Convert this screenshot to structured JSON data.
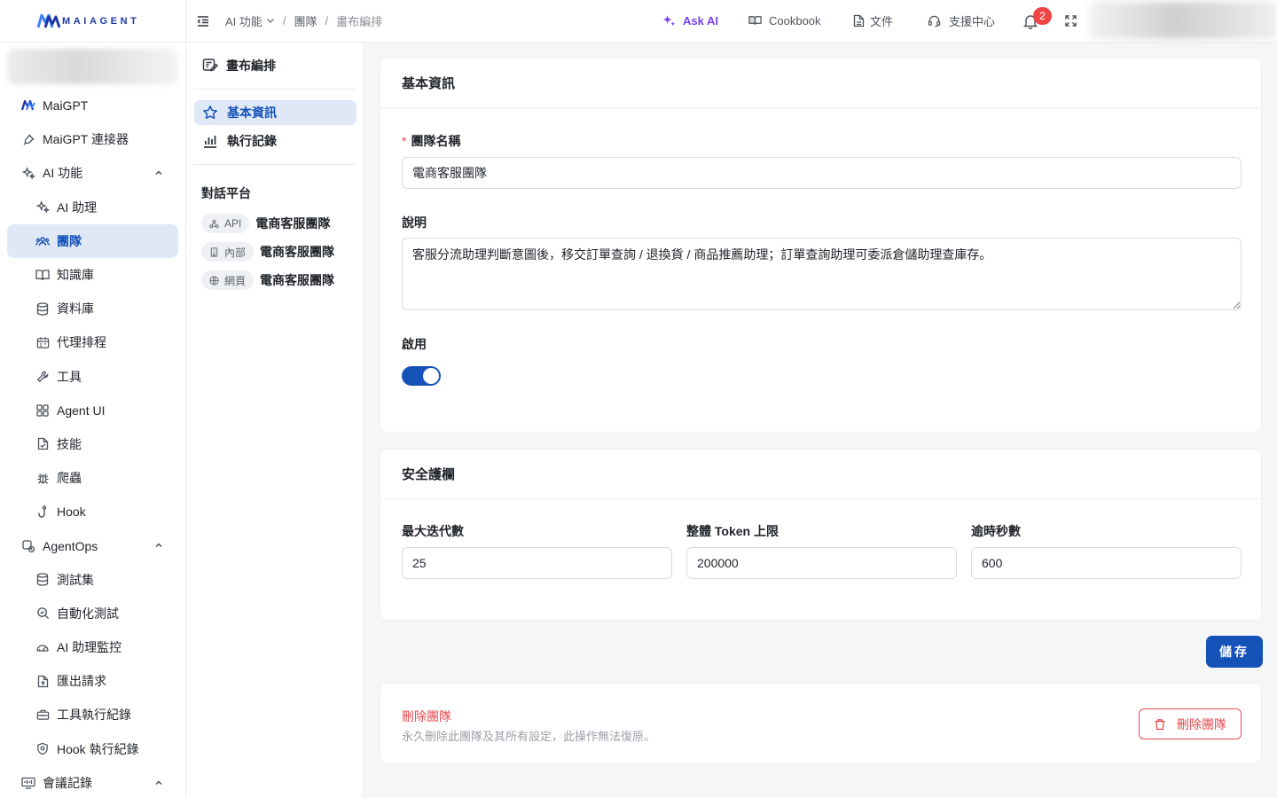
{
  "brand": {
    "name": "MAIAGENT"
  },
  "sidebar": {
    "items": [
      {
        "label": "MaiGPT",
        "icon": "maigpt-logo-icon"
      },
      {
        "label": "MaiGPT 連接器",
        "icon": "plug-icon"
      },
      {
        "label": "AI 功能",
        "icon": "sparkles-icon",
        "expanded": true
      },
      {
        "label": "AI 助理",
        "icon": "sparkle-icon"
      },
      {
        "label": "團隊",
        "icon": "team-icon",
        "active": true
      },
      {
        "label": "知識庫",
        "icon": "book-icon"
      },
      {
        "label": "資料庫",
        "icon": "database-icon"
      },
      {
        "label": "代理排程",
        "icon": "calendar-icon"
      },
      {
        "label": "工具",
        "icon": "wrench-icon"
      },
      {
        "label": "Agent UI",
        "icon": "grid-icon"
      },
      {
        "label": "技能",
        "icon": "file-icon"
      },
      {
        "label": "爬蟲",
        "icon": "bug-icon"
      },
      {
        "label": "Hook",
        "icon": "hook-icon"
      },
      {
        "label": "AgentOps",
        "icon": "agentops-icon",
        "expanded": true
      },
      {
        "label": "測試集",
        "icon": "database-icon"
      },
      {
        "label": "自動化測試",
        "icon": "search-icon"
      },
      {
        "label": "AI 助理監控",
        "icon": "gauge-icon"
      },
      {
        "label": "匯出請求",
        "icon": "export-icon"
      },
      {
        "label": "工具執行紀錄",
        "icon": "toolbox-icon"
      },
      {
        "label": "Hook 執行紀錄",
        "icon": "shield-icon"
      },
      {
        "label": "會議記錄",
        "icon": "meeting-icon",
        "expanded": true
      }
    ]
  },
  "topbar": {
    "breadcrumb": [
      "AI 功能",
      "團隊",
      "畫布編排"
    ],
    "ask_ai": "Ask AI",
    "cookbook": "Cookbook",
    "docs": "文件",
    "support": "支援中心",
    "notification_count": "2"
  },
  "subpanel": {
    "header": "畫布編排",
    "items": [
      {
        "label": "基本資訊",
        "icon": "star-icon",
        "active": true
      },
      {
        "label": "執行記錄",
        "icon": "bar-chart-icon"
      }
    ],
    "platform_section": "對話平台",
    "platforms": [
      {
        "tag": "API",
        "name": "電商客服團隊",
        "icon": "api-icon"
      },
      {
        "tag": "內部",
        "name": "電商客服團隊",
        "icon": "building-icon"
      },
      {
        "tag": "網頁",
        "name": "電商客服團隊",
        "icon": "globe-icon"
      }
    ]
  },
  "basic_info": {
    "title": "基本資訊",
    "name_label": "團隊名稱",
    "name_value": "電商客服團隊",
    "desc_label": "說明",
    "desc_value": "客服分流助理判斷意圖後，移交訂單查詢 / 退換貨 / 商品推薦助理；訂單查詢助理可委派倉儲助理查庫存。",
    "enabled_label": "啟用",
    "enabled": true
  },
  "guardrails": {
    "title": "安全護欄",
    "fields": [
      {
        "label": "最大迭代數",
        "value": "25"
      },
      {
        "label": "整體 Token 上限",
        "value": "200000"
      },
      {
        "label": "逾時秒數",
        "value": "600"
      }
    ]
  },
  "save_label": "儲存",
  "danger": {
    "title": "刪除團隊",
    "description": "永久刪除此團隊及其所有設定，此操作無法復原。",
    "button": "刪除團隊"
  },
  "colors": {
    "primary": "#1552b8",
    "danger": "#e5484d",
    "ask_ai": "#7a3ff2",
    "active_bg": "#dfe8f6"
  }
}
